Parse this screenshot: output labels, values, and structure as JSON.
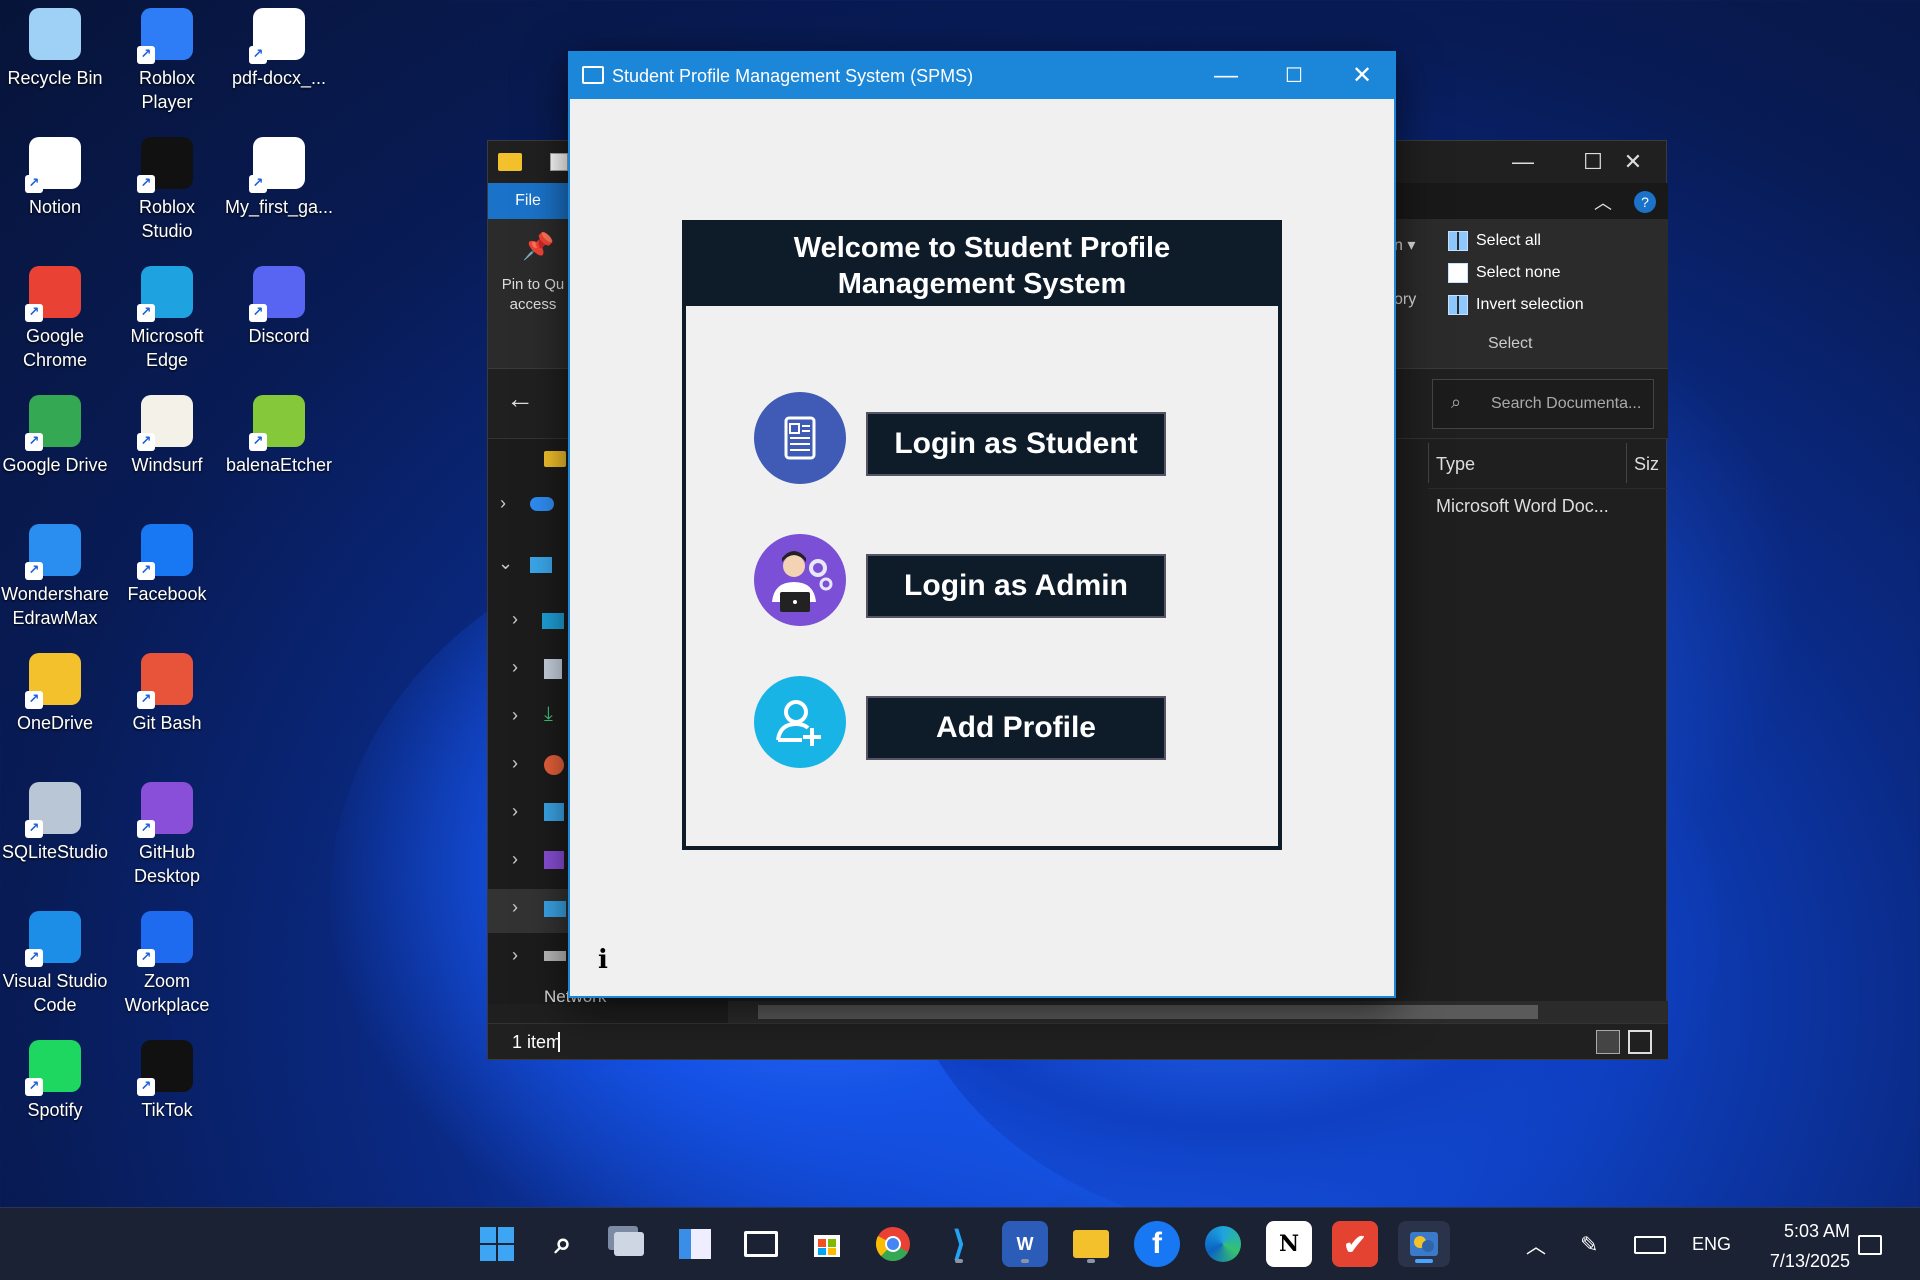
{
  "desktop": {
    "icons": [
      {
        "label": "Recycle Bin",
        "icon": "recycle-bin-icon",
        "color": "#9fd0f5"
      },
      {
        "label": "Roblox Player",
        "icon": "roblox-icon",
        "color": "#2f7df6"
      },
      {
        "label": "pdf-docx_...",
        "icon": "file-icon",
        "color": "#ffffff"
      },
      {
        "label": "Notion",
        "icon": "notion-icon",
        "color": "#ffffff"
      },
      {
        "label": "Roblox Studio",
        "icon": "roblox-studio-icon",
        "color": "#111111"
      },
      {
        "label": "My_first_ga...",
        "icon": "file-icon",
        "color": "#ffffff"
      },
      {
        "label": "Google Chrome",
        "icon": "chrome-icon",
        "color": "#e94235"
      },
      {
        "label": "Microsoft Edge",
        "icon": "edge-icon",
        "color": "#1fa3e0"
      },
      {
        "label": "Discord",
        "icon": "discord-icon",
        "color": "#5865f2"
      },
      {
        "label": "Google Drive",
        "icon": "google-drive-icon",
        "color": "#34a853"
      },
      {
        "label": "Windsurf",
        "icon": "windsurf-icon",
        "color": "#f4f1e8"
      },
      {
        "label": "balenaEtcher",
        "icon": "balena-etcher-icon",
        "color": "#85c93a"
      },
      {
        "label": "Wondershare EdrawMax",
        "icon": "edrawmax-icon",
        "color": "#2a8ef0"
      },
      {
        "label": "Facebook",
        "icon": "facebook-icon",
        "color": "#1877f2"
      },
      {
        "label": "OneDrive",
        "icon": "onedrive-icon",
        "color": "#f3c12b"
      },
      {
        "label": "Git Bash",
        "icon": "git-bash-icon",
        "color": "#e8543a"
      },
      {
        "label": "SQLiteStudio",
        "icon": "sqlitestudio-icon",
        "color": "#b9c6d6"
      },
      {
        "label": "GitHub Desktop",
        "icon": "github-desktop-icon",
        "color": "#8a4fd8"
      },
      {
        "label": "Visual Studio Code",
        "icon": "vscode-icon",
        "color": "#1c8ee8"
      },
      {
        "label": "Zoom Workplace",
        "icon": "zoom-icon",
        "color": "#1f6bf0"
      },
      {
        "label": "Spotify",
        "icon": "spotify-icon",
        "color": "#1ed760"
      },
      {
        "label": "TikTok",
        "icon": "tiktok-icon",
        "color": "#111111"
      }
    ]
  },
  "explorer": {
    "file_tab": "File",
    "pin_label": "Pin to Qu access",
    "select_all": "Select all",
    "select_none": "Select none",
    "invert_selection": "Invert selection",
    "select_group": "Select",
    "partial_ribbon_1": "n ▾",
    "partial_ribbon_2": "ory",
    "search_placeholder": "Search Documenta...",
    "col_type": "Type",
    "col_size": "Siz",
    "row_type": "Microsoft Word Doc...",
    "network": "Network",
    "status": "1 item"
  },
  "spms": {
    "title": "Student Profile Management System (SPMS)",
    "heading_line1": "Welcome to Student Profile",
    "heading_line2": "Management System",
    "btn_student": "Login as Student",
    "btn_admin": "Login as Admin",
    "btn_add": "Add Profile",
    "info": "i"
  },
  "taskbar": {
    "lang": "ENG",
    "time": "5:03 AM",
    "date": "7/13/2025"
  }
}
